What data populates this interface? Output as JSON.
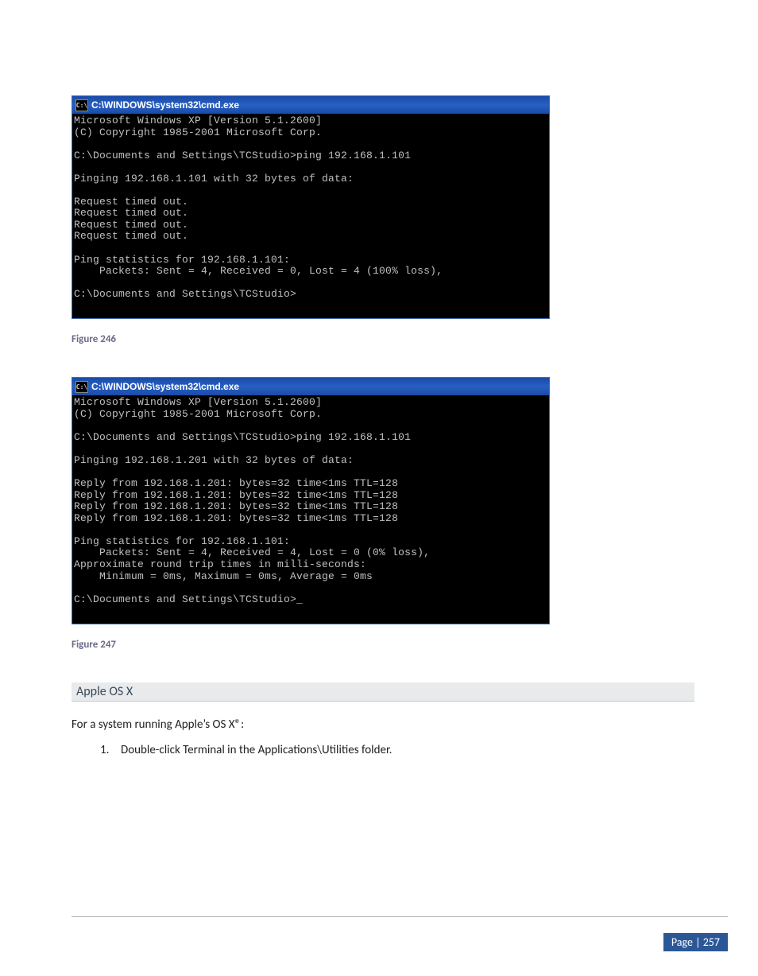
{
  "cmd1": {
    "icon_label": "C:\\",
    "title": "C:\\WINDOWS\\system32\\cmd.exe",
    "body": "Microsoft Windows XP [Version 5.1.2600]\n(C) Copyright 1985-2001 Microsoft Corp.\n\nC:\\Documents and Settings\\TCStudio>ping 192.168.1.101\n\nPinging 192.168.1.101 with 32 bytes of data:\n\nRequest timed out.\nRequest timed out.\nRequest timed out.\nRequest timed out.\n\nPing statistics for 192.168.1.101:\n    Packets: Sent = 4, Received = 0, Lost = 4 (100% loss),\n\nC:\\Documents and Settings\\TCStudio>\n\n"
  },
  "caption1": "Figure 246",
  "cmd2": {
    "icon_label": "C:\\",
    "title": "C:\\WINDOWS\\system32\\cmd.exe",
    "body": "Microsoft Windows XP [Version 5.1.2600]\n(C) Copyright 1985-2001 Microsoft Corp.\n\nC:\\Documents and Settings\\TCStudio>ping 192.168.1.101\n\nPinging 192.168.1.201 with 32 bytes of data:\n\nReply from 192.168.1.201: bytes=32 time<1ms TTL=128\nReply from 192.168.1.201: bytes=32 time<1ms TTL=128\nReply from 192.168.1.201: bytes=32 time<1ms TTL=128\nReply from 192.168.1.201: bytes=32 time<1ms TTL=128\n\nPing statistics for 192.168.1.101:\n    Packets: Sent = 4, Received = 4, Lost = 0 (0% loss),\nApproximate round trip times in milli-seconds:\n    Minimum = 0ms, Maximum = 0ms, Average = 0ms\n\nC:\\Documents and Settings\\TCStudio>_\n\n"
  },
  "caption2": "Figure 247",
  "section": "Apple OS X",
  "para1": "For a system running Apple’s OS X®:",
  "list1_num": "1.",
  "list1_text": "Double-click Terminal in the Applications\\Utilities folder.",
  "page_label": "Page | 257"
}
